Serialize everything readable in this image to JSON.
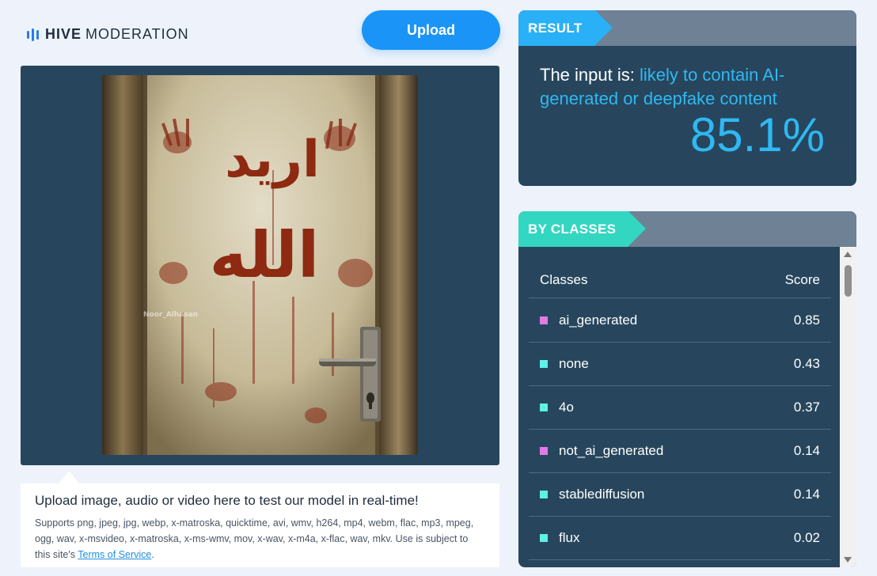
{
  "brand": {
    "bold": "HIVE",
    "rest": "MODERATION"
  },
  "upload_button": "Upload",
  "preview": {
    "watermark": "Noor_Alhasan",
    "door_text_line1": "اريد",
    "door_text_line2": "الله"
  },
  "info": {
    "title": "Upload image, audio or video here to test our model in real-time!",
    "desc": "Supports png, jpeg, jpg, webp, x-matroska, quicktime, avi, wmv, h264, mp4, webm, flac, mp3, mpeg, ogg, wav, x-msvideo, x-matroska, x-ms-wmv, mov, x-wav, x-m4a, x-flac, wav, mkv. Use is subject to this site's ",
    "link": "Terms of Service",
    "end": "."
  },
  "result": {
    "tag": "RESULT",
    "prefix": "The input is: ",
    "verdict": "likely to contain AI-generated or deepfake content",
    "percent": "85.1%",
    "accent_color": "#2fb8f3"
  },
  "classes": {
    "tag": "BY CLASSES",
    "col_class": "Classes",
    "col_score": "Score",
    "rows": [
      {
        "name": "ai_generated",
        "score": "0.85",
        "color": "#e07be8"
      },
      {
        "name": "none",
        "score": "0.43",
        "color": "#5ff0e6"
      },
      {
        "name": "4o",
        "score": "0.37",
        "color": "#5ff0e6"
      },
      {
        "name": "not_ai_generated",
        "score": "0.14",
        "color": "#e07be8"
      },
      {
        "name": "stablediffusion",
        "score": "0.14",
        "color": "#5ff0e6"
      },
      {
        "name": "flux",
        "score": "0.02",
        "color": "#5ff0e6"
      }
    ]
  }
}
